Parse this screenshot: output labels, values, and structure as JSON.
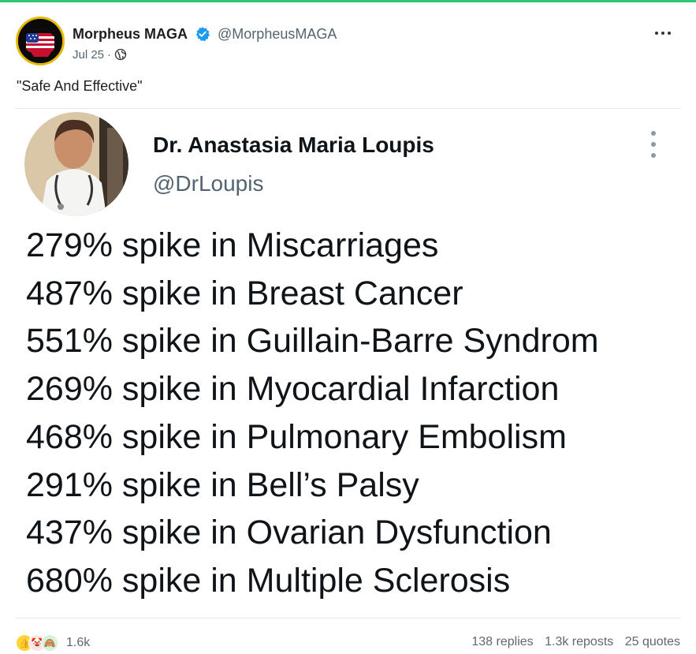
{
  "author": {
    "display_name": "Morpheus MAGA",
    "handle": "@MorpheusMAGA",
    "date": "Jul 25",
    "separator": "·"
  },
  "post": {
    "text": "\"Safe And Effective\""
  },
  "embedded_image": {
    "name": "Dr. Anastasia Maria Loupis",
    "handle": "@DrLoupis",
    "lines": [
      "279% spike in Miscarriages",
      "487% spike in Breast Cancer",
      "551% spike in Guillain-Barre Syndrom",
      "269% spike in Myocardial Infarction",
      "468% spike in Pulmonary Embolism",
      "291% spike in Bell’s Palsy",
      "437% spike in Ovarian Dysfunction",
      "680% spike in Multiple Sclerosis"
    ]
  },
  "footer": {
    "reaction_count": "1.6k",
    "replies": "138 replies",
    "reposts": "1.3k reposts",
    "quotes": "25 quotes"
  },
  "colors": {
    "top_border": "#2fc571",
    "verified": "#1d9bf0",
    "muted_text": "#536471"
  },
  "icons": [
    "verified-badge-icon",
    "globe-icon",
    "more-options-icon",
    "thumbs-up-icon",
    "clown-icon",
    "monkey-icon"
  ]
}
